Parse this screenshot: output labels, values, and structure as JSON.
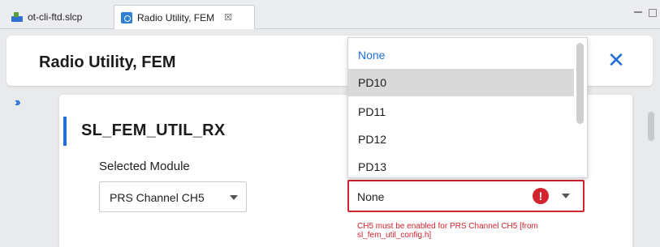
{
  "tabs": [
    {
      "label": "ot-cli-ftd.slcp",
      "icon": "slcp-project-icon"
    },
    {
      "label": "Radio Utility, FEM",
      "icon": "radio-utility-icon",
      "close": "☒"
    }
  ],
  "header": {
    "title": "Radio Utility, FEM"
  },
  "section": {
    "title": "SL_FEM_UTIL_RX",
    "selected_module_label": "Selected Module",
    "module_select_value": "PRS Channel CH5",
    "pin_select_value": "None",
    "error_text": "CH5 must be enabled for PRS Channel CH5 [from sl_fem_util_config.h]"
  },
  "dropdown": {
    "options": [
      "None",
      "PD10",
      "PD11",
      "PD12",
      "PD13"
    ],
    "highlighted": "PD10",
    "selected": "None"
  },
  "colors": {
    "accent": "#1e6fd9",
    "error": "#d3232f",
    "highlight": "#d9d9d9"
  }
}
